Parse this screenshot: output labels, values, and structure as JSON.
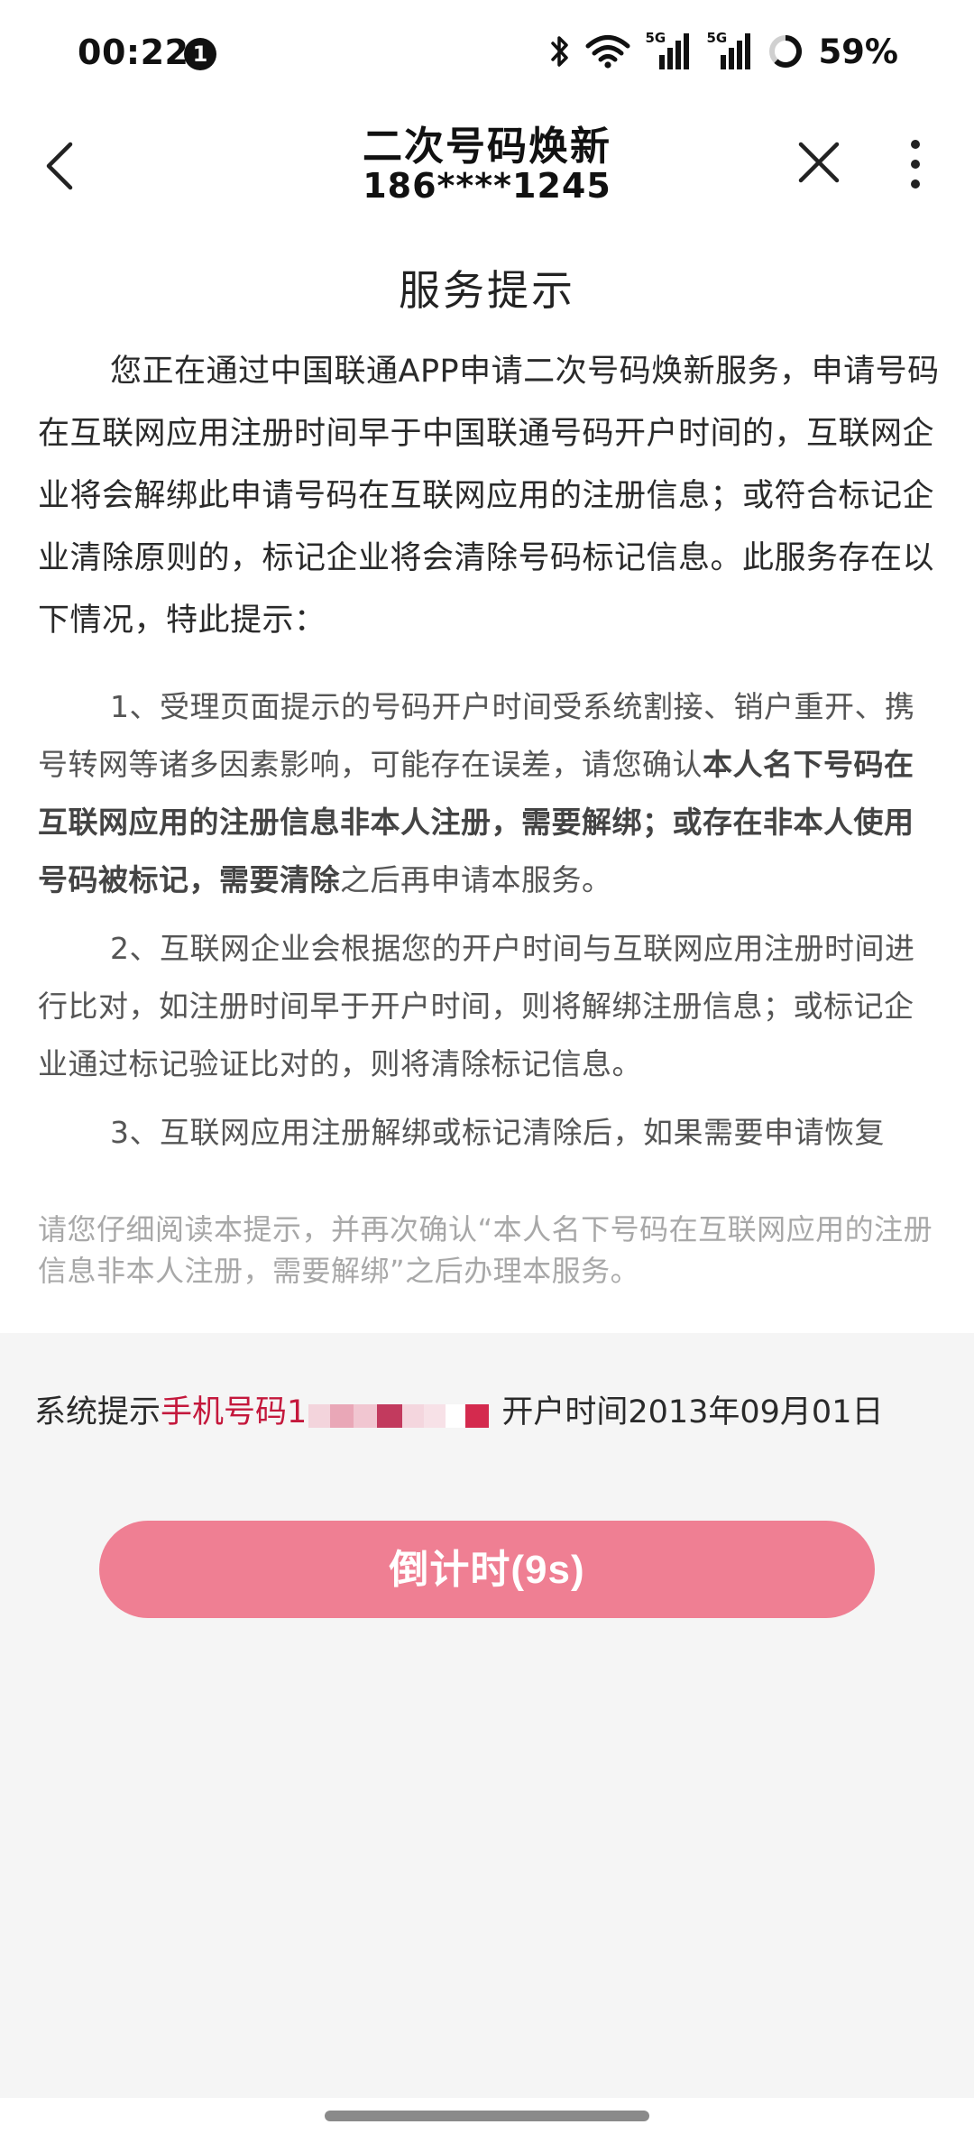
{
  "status_bar": {
    "time": "00:22",
    "notification_count": "1",
    "signal1_label": "5G",
    "signal2_label": "5G",
    "battery_percent": "59%"
  },
  "nav": {
    "title": "二次号码焕新",
    "subtitle": "186****1245",
    "icons": [
      "back-icon",
      "close-icon",
      "more-icon"
    ]
  },
  "content": {
    "heading": "服务提示",
    "intro": "您正在通过中国联通APP申请二次号码焕新服务，申请号码在互联网应用注册时间早于中国联通号码开户时间的，互联网企业将会解绑此申请号码在互联网应用的注册信息；或符合标记企业清除原则的，标记企业将会清除号码标记信息。此服务存在以下情况，特此提示：",
    "notes": [
      {
        "before": "1、受理页面提示的号码开户时间受系统割接、销户重开、携号转网等诸多因素影响，可能存在误差，请您确认",
        "bold": "本人名下号码在互联网应用的注册信息非本人注册，需要解绑；或存在非本人使用号码被标记，需要清除",
        "after": "之后再申请本服务。"
      },
      {
        "text": "2、互联网企业会根据您的开户时间与互联网应用注册时间进行比对，如注册时间早于开户时间，则将解绑注册信息；或标记企业通过标记验证比对的，则将清除标记信息。"
      },
      {
        "text": "3、互联网应用注册解绑或标记清除后，如果需要申请恢复"
      }
    ],
    "reminder": "请您仔细阅读本提示，并再次确认“本人名下号码在互联网应用的注册信息非本人注册，需要解绑”之后办理本服务。"
  },
  "system_tip": {
    "label": "系统提示",
    "phone_label": "手机号码",
    "phone_prefix": "1",
    "open_time_text": "开户时间2013年09月01日"
  },
  "countdown_button": {
    "label": "倒计时(9s)"
  },
  "colors": {
    "accent_red": "#c4183c",
    "button_pink": "#ef7f93",
    "page_gray": "#f5f5f5"
  }
}
